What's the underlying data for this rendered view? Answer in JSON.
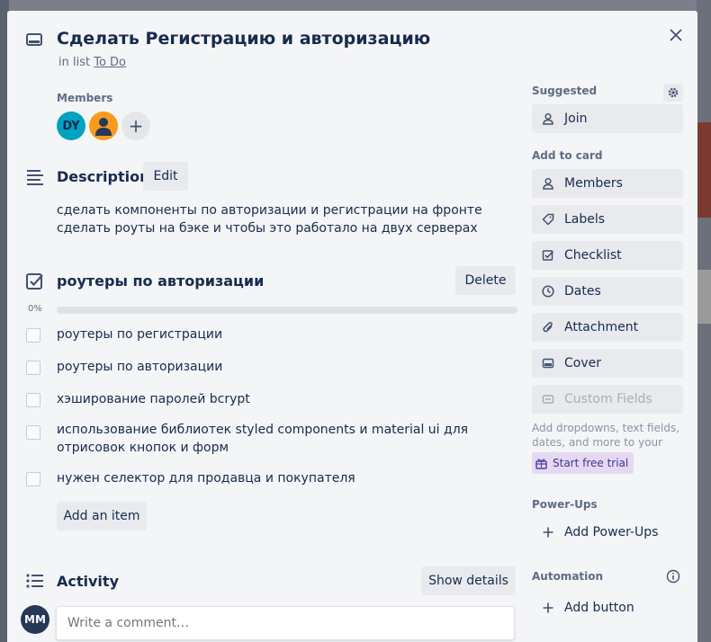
{
  "card": {
    "title": "Сделать Регистрацию и авторизацию",
    "in_list_prefix": "in list",
    "list_name": "To Do"
  },
  "members": {
    "label": "Members",
    "avatars": [
      {
        "initials": "DY",
        "color": "#00a3bf"
      },
      {
        "initials": "",
        "color": "#f79a1e"
      }
    ],
    "add_symbol": "+"
  },
  "description": {
    "title": "Description",
    "edit_label": "Edit",
    "lines": [
      "сделать компоненты по авторизации и регистрации на фронте",
      "сделать роуты на бэке и чтобы это работало на двух серверах"
    ]
  },
  "checklist": {
    "title": "роутеры по авторизации",
    "delete_label": "Delete",
    "progress_text": "0%",
    "progress": 0,
    "items": [
      {
        "text": "роутеры по регистрации",
        "checked": false
      },
      {
        "text": "роутеры по авторизации",
        "checked": false
      },
      {
        "text": "хэширование паролей bcrypt",
        "checked": false
      },
      {
        "text": "использование библиотек styled components и material ui для",
        "text2": "отрисовок кнопок и форм",
        "checked": false
      },
      {
        "text": "нужен селектор для продавца и покупателя",
        "checked": false
      }
    ],
    "add_item_label": "Add an item"
  },
  "activity": {
    "title": "Activity",
    "show_details_label": "Show details",
    "user_initials": "MM",
    "comment_placeholder": "Write a comment…"
  },
  "sidebar": {
    "suggested_label": "Suggested",
    "join_label": "Join",
    "add_to_card_label": "Add to card",
    "add_to_card": [
      {
        "label": "Members",
        "icon": "person-icon"
      },
      {
        "label": "Labels",
        "icon": "tag-icon"
      },
      {
        "label": "Checklist",
        "icon": "checklist-icon"
      },
      {
        "label": "Dates",
        "icon": "clock-icon"
      },
      {
        "label": "Attachment",
        "icon": "paperclip-icon"
      },
      {
        "label": "Cover",
        "icon": "cover-icon"
      },
      {
        "label": "Custom Fields",
        "icon": "custom-fields-icon"
      }
    ],
    "hint_text": "Add dropdowns, text fields, dates, and more to your cards.",
    "trial_label": "Start free trial",
    "powerups_label": "Power-Ups",
    "add_powerups_label": "Add Power-Ups",
    "automation_label": "Automation",
    "add_button_label": "Add button"
  },
  "colors": {
    "modal_bg": "#f4f5f7",
    "button_bg": "#e8eaee",
    "text": "#172b4d",
    "muted": "#5e6c84",
    "trial_bg": "#e5d9f2",
    "trial_text": "#403294"
  }
}
